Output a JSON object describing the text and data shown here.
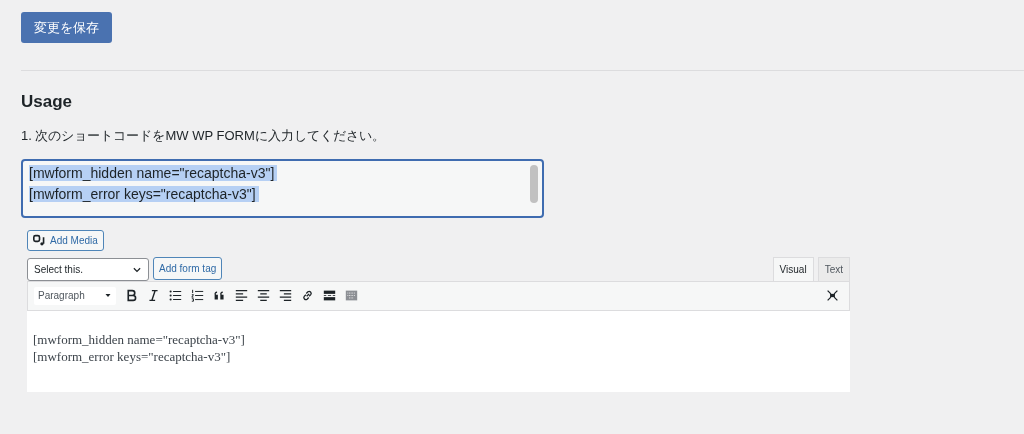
{
  "save_button": "変更を保存",
  "heading": "Usage",
  "instruction": "1. 次のショートコードをMW WP FORMに入力してください。",
  "shortcode_field": {
    "lines": [
      "[mwform_hidden name=\"recaptcha-v3\"]",
      "[mwform_error keys=\"recaptcha-v3\"]"
    ],
    "text_selected": true
  },
  "editor": {
    "add_media": "Add Media",
    "tag_select": {
      "value": "Select this."
    },
    "add_form_tag": "Add form tag",
    "tabs": [
      {
        "label": "Visual",
        "selected": true
      },
      {
        "label": "Text",
        "selected": false
      }
    ],
    "format_select": "Paragraph",
    "content": [
      "[mwform_hidden name=\"recaptcha-v3\"]",
      "[mwform_error keys=\"recaptcha-v3\"]"
    ]
  }
}
